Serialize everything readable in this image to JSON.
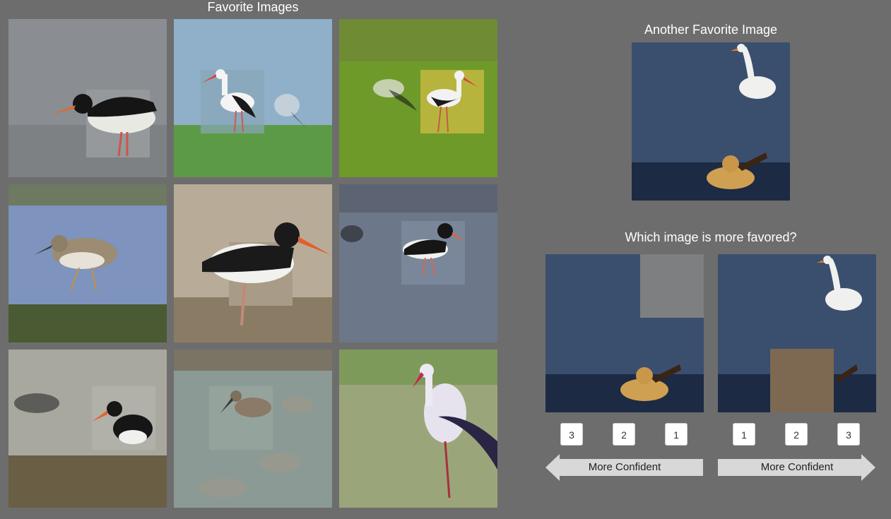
{
  "left_panel": {
    "title": "Favorite Images",
    "tiles": [
      {
        "name": "oystercatcher-1",
        "bg": "#8a8e92",
        "bird": "oystercatcher"
      },
      {
        "name": "stork-1",
        "bg": "#8fb0c8",
        "bird": "stork"
      },
      {
        "name": "stork-2",
        "bg": "#6e9a2a",
        "bird": "stork"
      },
      {
        "name": "sandpiper-1",
        "bg": "#7e93bd",
        "bird": "sandpiper"
      },
      {
        "name": "oystercatcher-2",
        "bg": "#b8ac98",
        "bird": "oystercatcher"
      },
      {
        "name": "oystercatcher-3",
        "bg": "#6c7789",
        "bird": "oystercatcher"
      },
      {
        "name": "oystercatcher-4",
        "bg": "#a9a89f",
        "bird": "oystercatcher"
      },
      {
        "name": "godwit-1",
        "bg": "#8b9a94",
        "bird": "sandpiper"
      },
      {
        "name": "stork-3",
        "bg": "#9aa67a",
        "bird": "stork"
      }
    ]
  },
  "right_panel": {
    "title": "Another Favorite Image",
    "question": "Which image is more favored?",
    "left_choice": {
      "ranks": [
        "3",
        "2",
        "1"
      ],
      "arrow_label": "More Confident",
      "occluder_color": "#7d7f80"
    },
    "right_choice": {
      "ranks": [
        "1",
        "2",
        "3"
      ],
      "arrow_label": "More Confident",
      "occluder_color": "#7d6852"
    }
  }
}
